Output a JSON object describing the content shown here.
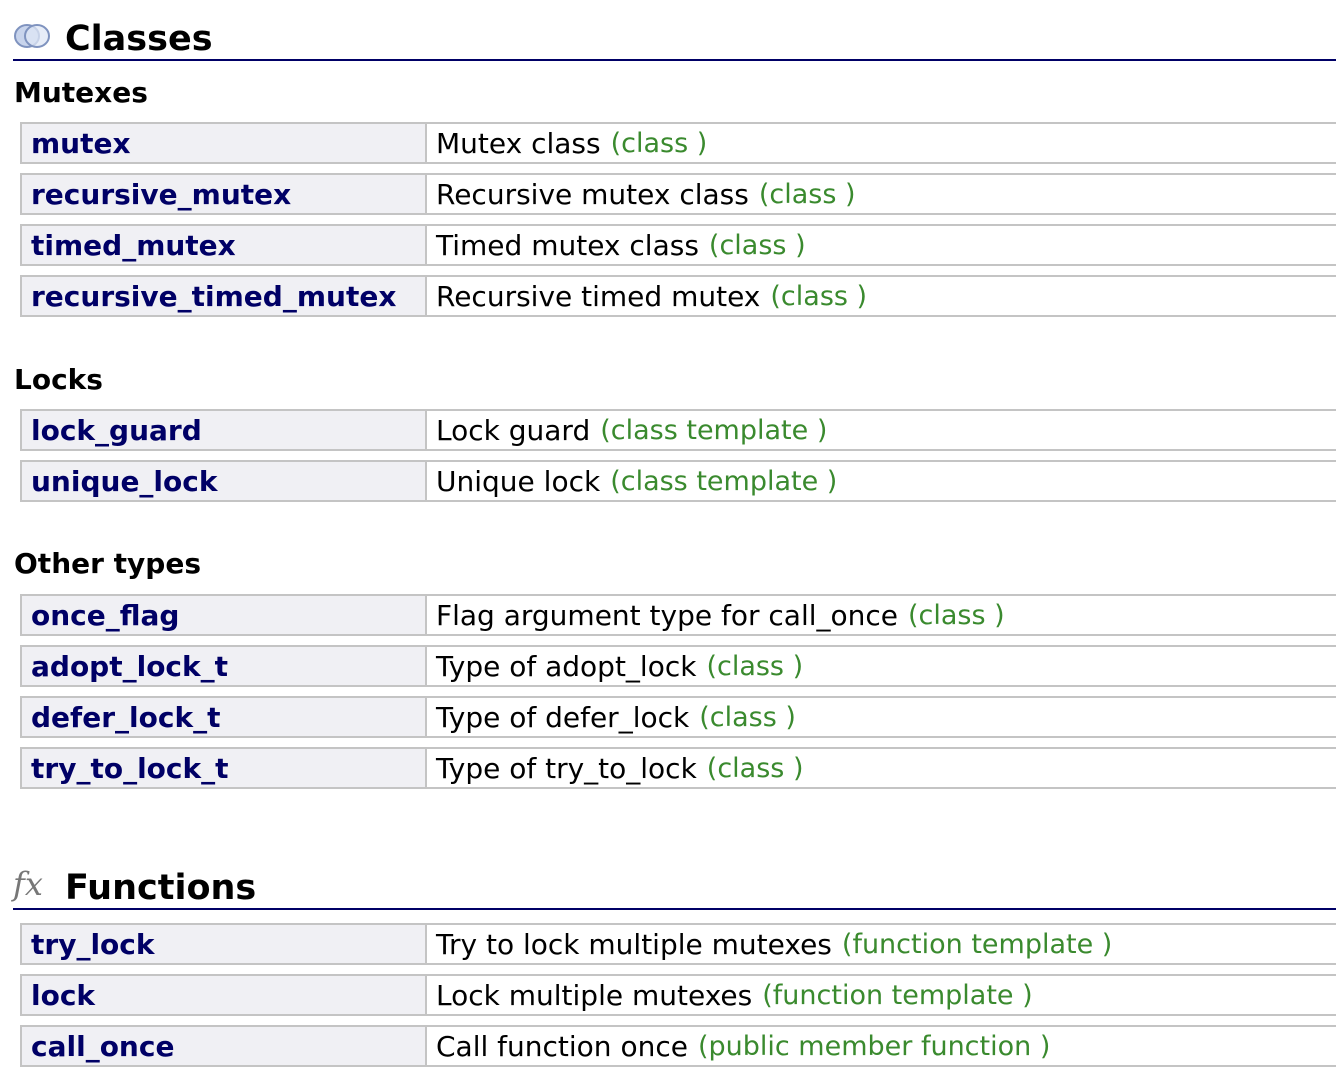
{
  "classes": {
    "icon": "classes-icon",
    "title": "Classes",
    "groups": [
      {
        "title": "Mutexes",
        "items": [
          {
            "name": "mutex",
            "desc": "Mutex class",
            "kind": "(class )"
          },
          {
            "name": "recursive_mutex",
            "desc": "Recursive mutex class",
            "kind": "(class )"
          },
          {
            "name": "timed_mutex",
            "desc": "Timed mutex class",
            "kind": "(class )"
          },
          {
            "name": "recursive_timed_mutex",
            "desc": "Recursive timed mutex",
            "kind": "(class )"
          }
        ]
      },
      {
        "title": "Locks",
        "items": [
          {
            "name": "lock_guard",
            "desc": "Lock guard",
            "kind": "(class template )"
          },
          {
            "name": "unique_lock",
            "desc": "Unique lock",
            "kind": "(class template )"
          }
        ]
      },
      {
        "title": "Other types",
        "items": [
          {
            "name": "once_flag",
            "desc": "Flag argument type for call_once",
            "kind": "(class )"
          },
          {
            "name": "adopt_lock_t",
            "desc": "Type of adopt_lock",
            "kind": "(class )"
          },
          {
            "name": "defer_lock_t",
            "desc": "Type of defer_lock",
            "kind": "(class )"
          },
          {
            "name": "try_to_lock_t",
            "desc": "Type of try_to_lock",
            "kind": "(class )"
          }
        ]
      }
    ]
  },
  "functions": {
    "icon": "fx-icon",
    "icon_text": "fx",
    "title": "Functions",
    "items": [
      {
        "name": "try_lock",
        "desc": "Try to lock multiple mutexes",
        "kind": "(function template )"
      },
      {
        "name": "lock",
        "desc": "Lock multiple mutexes",
        "kind": "(function template )"
      },
      {
        "name": "call_once",
        "desc": "Call function once",
        "kind": "(public member function )"
      }
    ]
  },
  "colors": {
    "link": "#000066",
    "kind": "#3a8a2e",
    "name_cell_bg": "#f0f0f4",
    "border": "#c4c4c4"
  }
}
